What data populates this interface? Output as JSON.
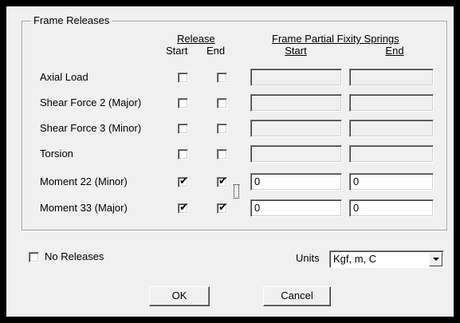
{
  "group_title": "Frame Releases",
  "headers": {
    "release": "Release",
    "fixity": "Frame Partial Fixity Springs",
    "start": "Start",
    "end": "End",
    "fix_start": "Start",
    "fix_end": "End"
  },
  "rows": [
    {
      "label": "Axial Load",
      "start_checked": false,
      "end_checked": false,
      "fix_start": "",
      "fix_end": "",
      "enabled": false
    },
    {
      "label": "Shear Force 2 (Major)",
      "start_checked": false,
      "end_checked": false,
      "fix_start": "",
      "fix_end": "",
      "enabled": false
    },
    {
      "label": "Shear Force 3 (Minor)",
      "start_checked": false,
      "end_checked": false,
      "fix_start": "",
      "fix_end": "",
      "enabled": false
    },
    {
      "label": "Torsion",
      "start_checked": false,
      "end_checked": false,
      "fix_start": "",
      "fix_end": "",
      "enabled": false
    },
    {
      "label": "Moment 22 (Minor)",
      "start_checked": true,
      "end_checked": true,
      "fix_start": "0",
      "fix_end": "0",
      "enabled": true
    },
    {
      "label": "Moment 33 (Major)",
      "start_checked": true,
      "end_checked": true,
      "fix_start": "0",
      "fix_end": "0",
      "enabled": true
    }
  ],
  "no_releases": {
    "label": "No Releases",
    "checked": false
  },
  "units": {
    "label": "Units",
    "value": "Kgf, m, C"
  },
  "buttons": {
    "ok": "OK",
    "cancel": "Cancel"
  }
}
